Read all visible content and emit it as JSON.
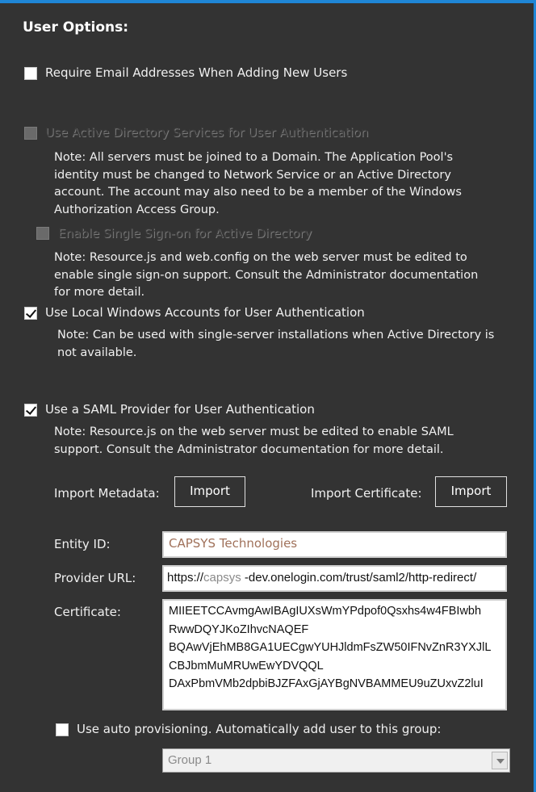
{
  "title": "User Options:",
  "options": {
    "require_email": {
      "label": "Require Email Addresses When Adding New Users",
      "checked": false
    },
    "active_directory": {
      "label": "Use Active Directory Services for User Authentication",
      "checked": false,
      "enabled": false,
      "note_lines": [
        "Note:  All servers must be joined to a Domain.  The Application Pool's",
        "identity must be changed to Network Service or an Active Directory",
        "account.  The account may also need to be a member of the Windows",
        "Authorization Access Group."
      ]
    },
    "sso": {
      "label": "Enable Single Sign-on for Active Directory",
      "checked": false,
      "enabled": false,
      "note_lines": [
        "Note:  Resource.js and web.config on the web server must be edited to",
        "enable single sign-on support.  Consult the Administrator documentation",
        "for more detail."
      ]
    },
    "local_windows": {
      "label": "Use Local Windows Accounts for User Authentication",
      "checked": true,
      "note_lines": [
        "Note:  Can be used with single-server installations when Active Directory is",
        "not available."
      ]
    },
    "saml": {
      "label": "Use a SAML Provider for User Authentication",
      "checked": true,
      "note_lines": [
        "Note:  Resource.js on the web server must be edited to enable SAML",
        "support.  Consult the Administrator documentation for more detail."
      ]
    }
  },
  "saml_config": {
    "import_metadata_label": "Import Metadata:",
    "import_metadata_button": "Import",
    "import_certificate_label": "Import Certificate:",
    "import_certificate_button": "Import",
    "entity_id_label": "Entity ID:",
    "entity_id_value": "CAPSYS Technologies",
    "provider_url_label": "Provider URL:",
    "provider_url_prefix": "https://",
    "provider_url_highlight": "capsys",
    "provider_url_rest": " -dev.onelogin.com/trust/saml2/http-redirect/",
    "certificate_label": "Certificate:",
    "certificate_lines": [
      "MIIEETCCAvmgAwIBAgIUXsWmYPdpof0Qsxhs4w4FBIwbh",
      "RwwDQYJKoZIhvcNAQEF",
      "BQAwVjEhMB8GA1UECgwYUHJldmFsZW50IFNvZnR3YXJlL",
      "CBJbmMuMRUwEwYDVQQL",
      "DAxPbmVMb2dpbiBJZFAxGjAYBgNVBAMMEU9uZUxvZ2luI"
    ]
  },
  "auto_provisioning": {
    "label": "Use auto provisioning.  Automatically add user to this group:",
    "checked": false,
    "group_selected": "Group 1"
  },
  "colors": {
    "background": "#333333",
    "accent": "#1f86d6",
    "entity_text": "#a0715a"
  }
}
